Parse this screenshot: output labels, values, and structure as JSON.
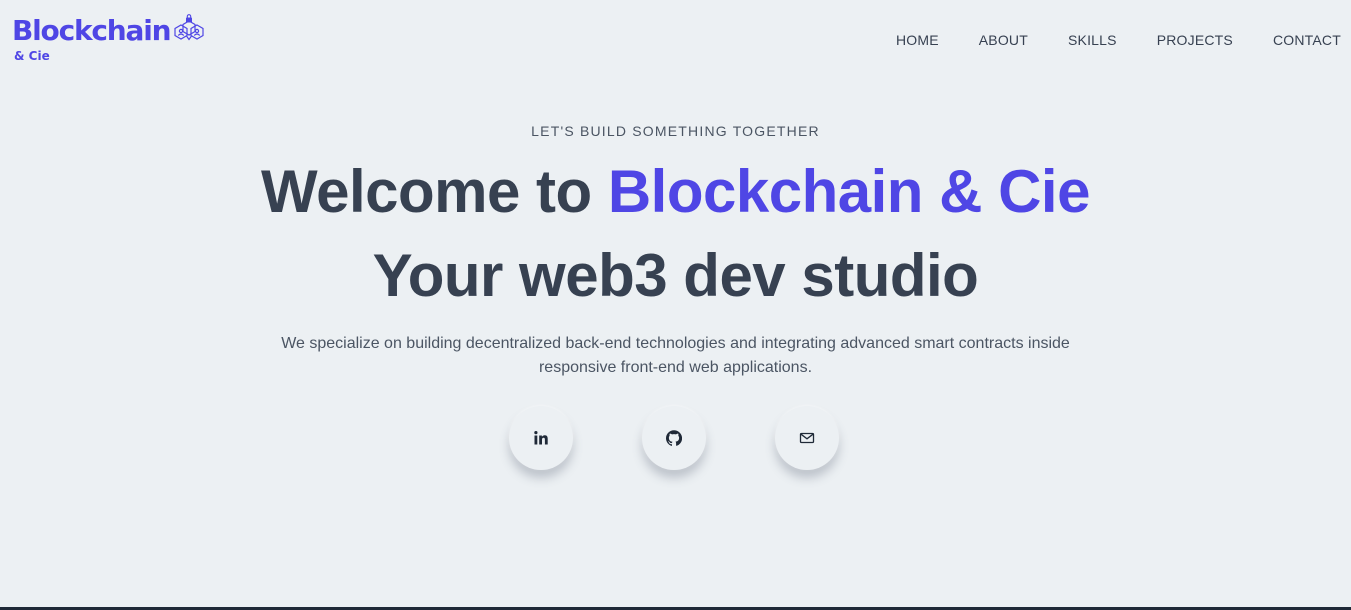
{
  "brand": {
    "name": "Blockchain",
    "sub": "& Cie",
    "logo_icon": "blockchain-lock-nodes-icon"
  },
  "nav": {
    "items": [
      {
        "label": "HOME"
      },
      {
        "label": "ABOUT"
      },
      {
        "label": "SKILLS"
      },
      {
        "label": "PROJECTS"
      },
      {
        "label": "CONTACT"
      }
    ]
  },
  "hero": {
    "eyebrow": "LET'S BUILD SOMETHING TOGETHER",
    "headline_prefix": "Welcome to ",
    "headline_accent": "Blockchain & Cie",
    "headline_line2": "Your web3 dev studio",
    "lead": "We specialize on building decentralized back-end technologies and integrating advanced smart contracts inside responsive front-end web applications."
  },
  "socials": [
    {
      "icon": "linkedin-icon"
    },
    {
      "icon": "github-icon"
    },
    {
      "icon": "mail-icon"
    }
  ],
  "colors": {
    "background": "#ecf0f3",
    "accent": "#4f46e5",
    "text_dark": "#374151",
    "text_muted": "#4b5563"
  }
}
